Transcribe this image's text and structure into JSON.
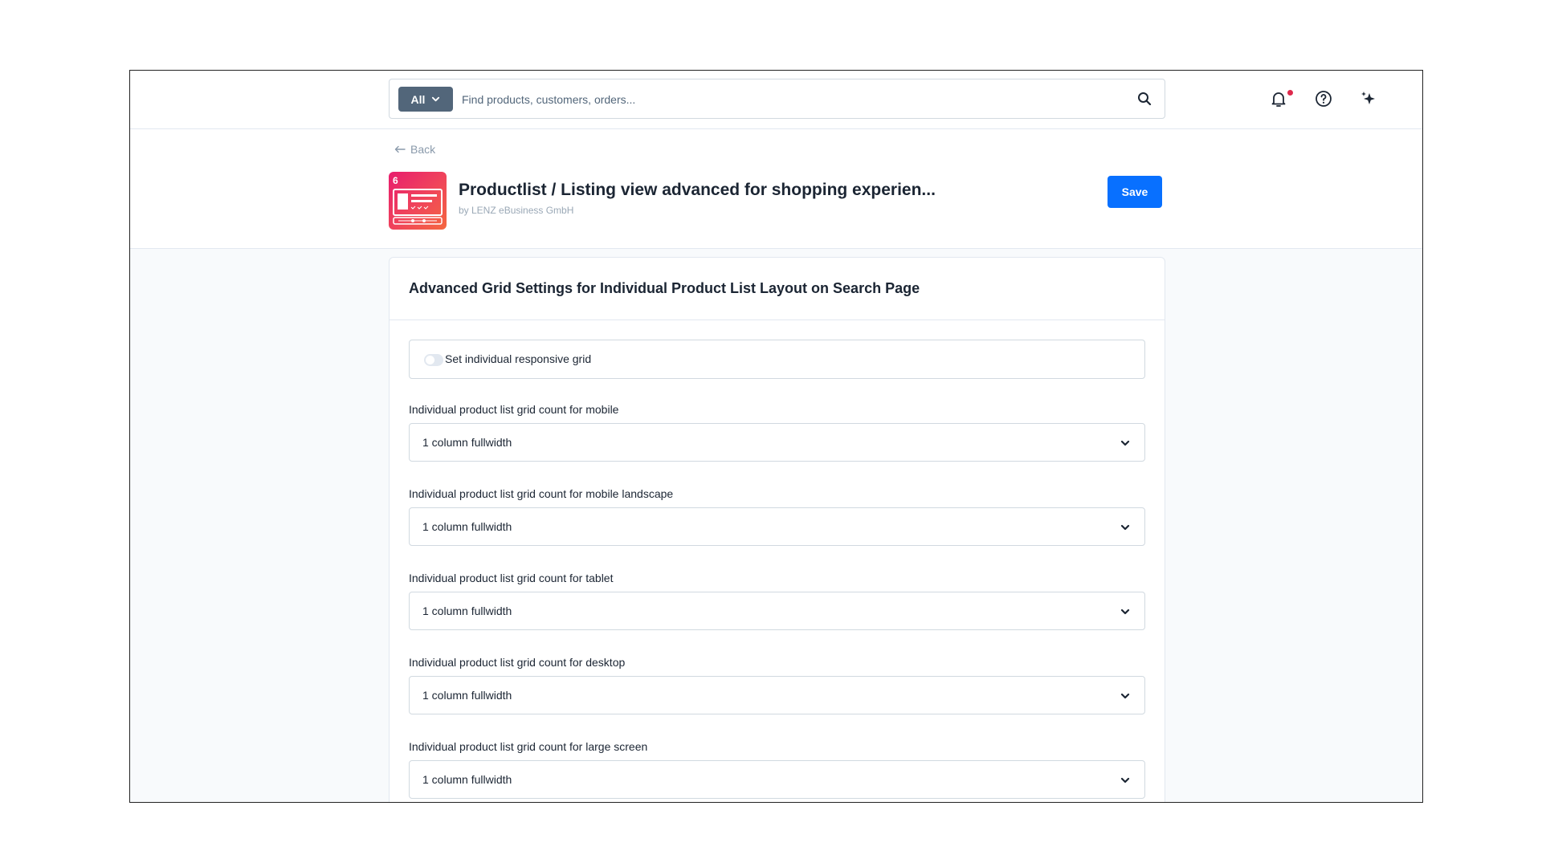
{
  "search": {
    "scope": "All",
    "placeholder": "Find products, customers, orders..."
  },
  "header": {
    "back_label": "Back",
    "app_title": "Productlist / Listing view advanced for shopping experien...",
    "vendor": "by LENZ eBusiness GmbH",
    "logo_badge": "6",
    "save_label": "Save"
  },
  "card": {
    "title": "Advanced Grid Settings for Individual Product List Layout on Search Page",
    "toggle_label": "Set individual responsive grid",
    "toggle_on": false,
    "fields": [
      {
        "label": "Individual product list grid count for mobile",
        "value": "1 column fullwidth"
      },
      {
        "label": "Individual product list grid count for mobile landscape",
        "value": "1 column fullwidth"
      },
      {
        "label": "Individual product list grid count for tablet",
        "value": "1 column fullwidth"
      },
      {
        "label": "Individual product list grid count for desktop",
        "value": "1 column fullwidth"
      },
      {
        "label": "Individual product list grid count for large screen",
        "value": "1 column fullwidth"
      }
    ]
  },
  "colors": {
    "primary": "#0870ff",
    "scope_button": "#52667a",
    "notification_dot": "#de294c",
    "logo_gradient_start": "#e81d6e",
    "logo_gradient_end": "#f5673f"
  },
  "icons": [
    "chevron-down-icon",
    "search-icon",
    "bell-icon",
    "help-icon",
    "sparkle-icon",
    "arrow-left-icon"
  ]
}
